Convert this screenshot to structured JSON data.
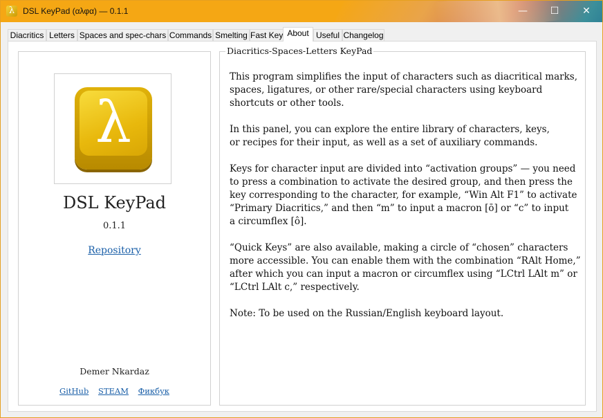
{
  "window": {
    "title": "DSL KeyPad (αλφα)  —  0.1.1",
    "icon_glyph": "λ",
    "controls": {
      "minimize": "—",
      "maximize": "☐",
      "close": "✕"
    },
    "accent": "#f5a714"
  },
  "tabs": [
    {
      "label": "Diacritics"
    },
    {
      "label": "Letters"
    },
    {
      "label": "Spaces and spec-chars"
    },
    {
      "label": "Commands"
    },
    {
      "label": "Smelting"
    },
    {
      "label": "Fast Keys"
    },
    {
      "label": "About",
      "active": true
    },
    {
      "label": "Useful"
    },
    {
      "label": "Changelog"
    }
  ],
  "about": {
    "logo_glyph": "λ",
    "app_name": "DSL KeyPad",
    "version": "0.1.1",
    "repository_link": "Repository",
    "author": "Demer Nkardaz",
    "links": [
      "GitHub",
      "STEAM",
      "Фикбук"
    ],
    "group_title": "Diacritics-Spaces-Letters KeyPad",
    "paragraphs": [
      "This program simplifies the input of characters such as diacritical marks,\nspaces, ligatures, or other rare/special characters using keyboard\nshortcuts or other tools.",
      "In this panel, you can explore the entire library of characters, keys,\nor recipes for their input, as well as a set of auxiliary commands.",
      "Keys for character input are divided into “activation groups” — you need\nto press a combination to activate the desired group, and then press the\nkey corresponding to the character, for example, “Win Alt F1” to activate\n“Primary Diacritics,” and then “m” to input a macron [ō] or “c” to input\na circumflex [ô].",
      "“Quick Keys” are also available, making a circle of “chosen” characters\nmore accessible. You can enable them with the combination “RAlt Home,”\nafter which you can input a macron or circumflex using “LCtrl LAlt m” or\n“LCtrl LAlt c,” respectively.",
      "Note: To be used on the Russian/English keyboard layout."
    ]
  }
}
